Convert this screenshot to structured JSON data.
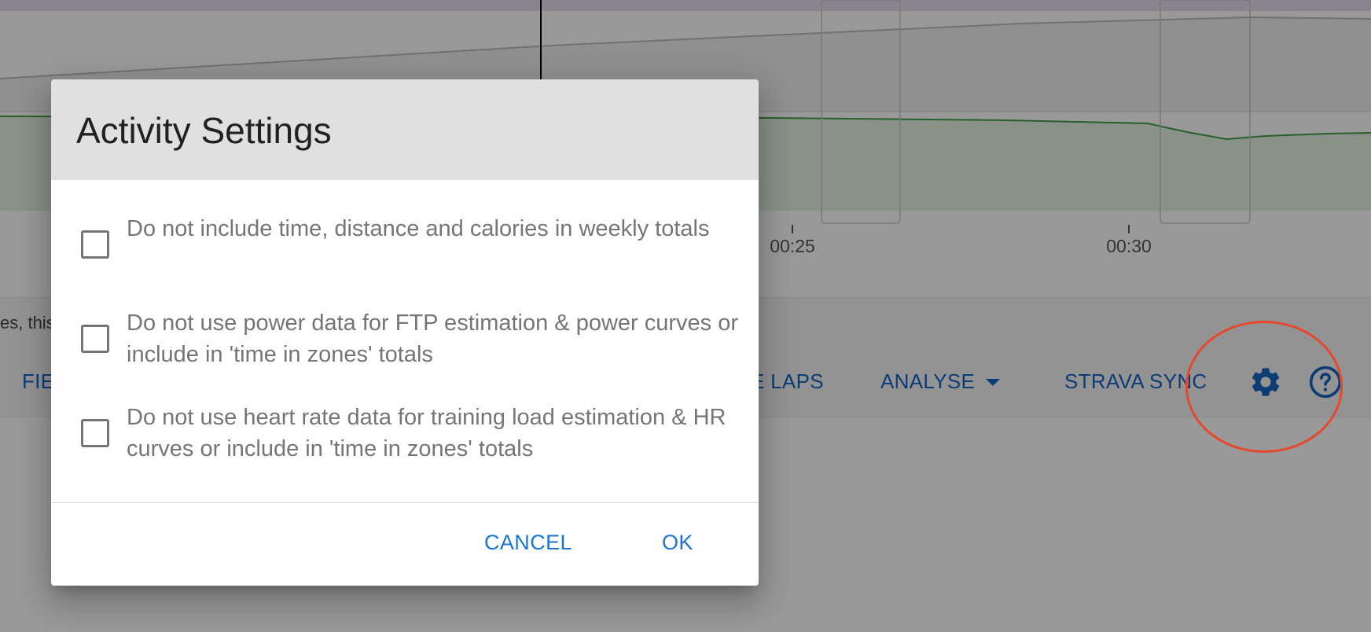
{
  "chart": {
    "x_ticks": [
      "00:25",
      "00:30"
    ]
  },
  "toolbar": {
    "hint_text": "es, this",
    "fields_label_partial": "FIE",
    "laps_label_partial": "E LAPS",
    "analyse_label": "ANALYSE",
    "strava_sync_label": "STRAVA SYNC"
  },
  "dialog": {
    "title": "Activity Settings",
    "options": [
      {
        "label": "Do not include time, distance and calories in weekly totals",
        "checked": false
      },
      {
        "label": "Do not use power data for FTP estimation & power curves or include in 'time in zones' totals",
        "checked": false
      },
      {
        "label": "Do not use heart rate data for training load estimation & HR curves or include in 'time in zones' totals",
        "checked": false
      }
    ],
    "cancel_label": "CANCEL",
    "ok_label": "OK"
  },
  "colors": {
    "accent": "#1976d2",
    "toolbar_button": "#1565c0",
    "annotation": "#e5482b",
    "power_series": "#43a047"
  },
  "icons": {
    "settings": "gear-icon",
    "help": "help-circle-icon",
    "dropdown": "arrow-drop-down-icon"
  }
}
